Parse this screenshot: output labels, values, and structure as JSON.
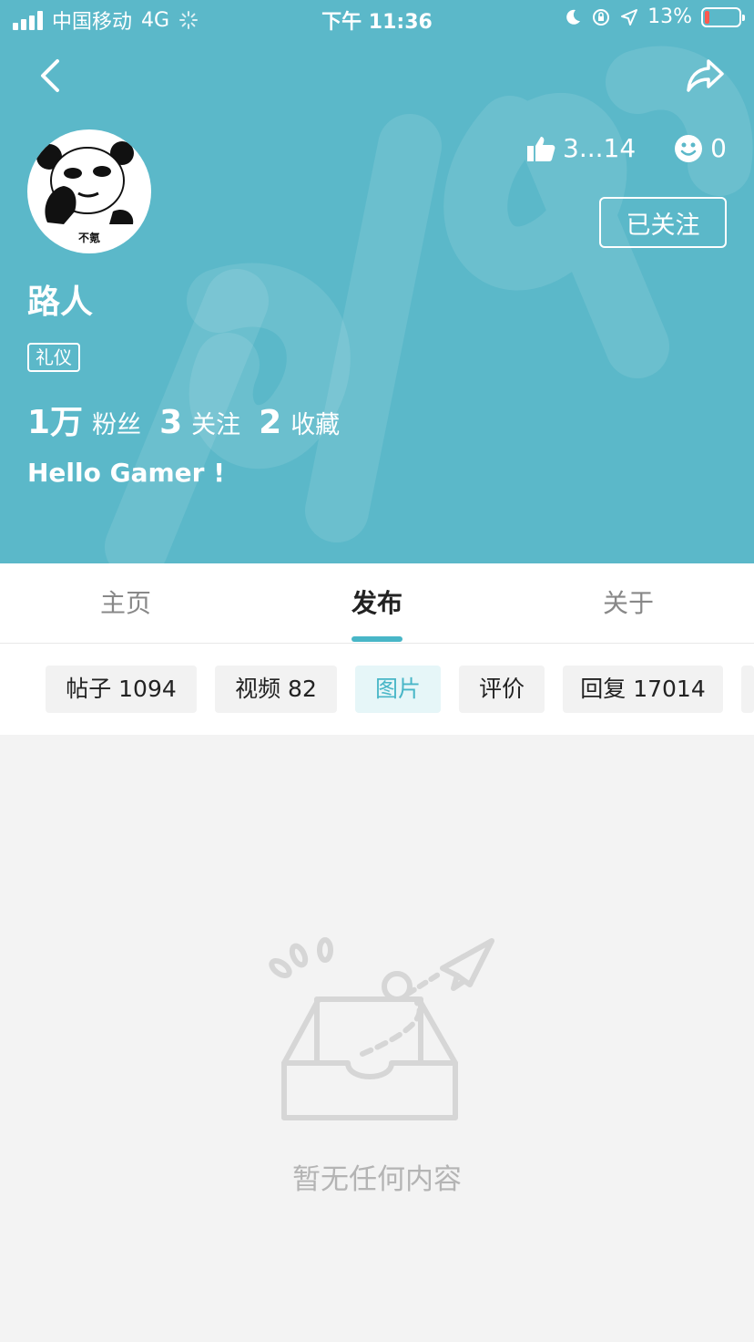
{
  "colors": {
    "accent": "#5bb8c9",
    "tab_indicator": "#48b6c7",
    "battery_low": "#ff5a4f"
  },
  "status_bar": {
    "carrier": "中国移动",
    "network": "4G",
    "time": "下午 11:36",
    "battery": "13%",
    "battery_level": 0.13
  },
  "header": {
    "back_icon": "chevron-left-icon",
    "share_icon": "share-arrow-icon"
  },
  "profile": {
    "avatar_caption": "不氪",
    "likes": "3...14",
    "smiles": "0",
    "follow_label": "已关注",
    "username": "路人",
    "tag": "礼仪",
    "fans_count": "1万",
    "fans_label": "粉丝",
    "following_count": "3",
    "following_label": "关注",
    "favorites_count": "2",
    "favorites_label": "收藏",
    "bio": "Hello Gamer !"
  },
  "tabs": [
    {
      "label": "主页"
    },
    {
      "label": "发布",
      "active": true
    },
    {
      "label": "关于"
    }
  ],
  "chips": [
    {
      "label": "帖子 1094"
    },
    {
      "label": "视频 82"
    },
    {
      "label": "图片",
      "active": true
    },
    {
      "label": "评价"
    },
    {
      "label": "回复 17014"
    }
  ],
  "empty_state": {
    "icon": "empty-inbox-paper-plane-icon",
    "text": "暂无任何内容"
  }
}
